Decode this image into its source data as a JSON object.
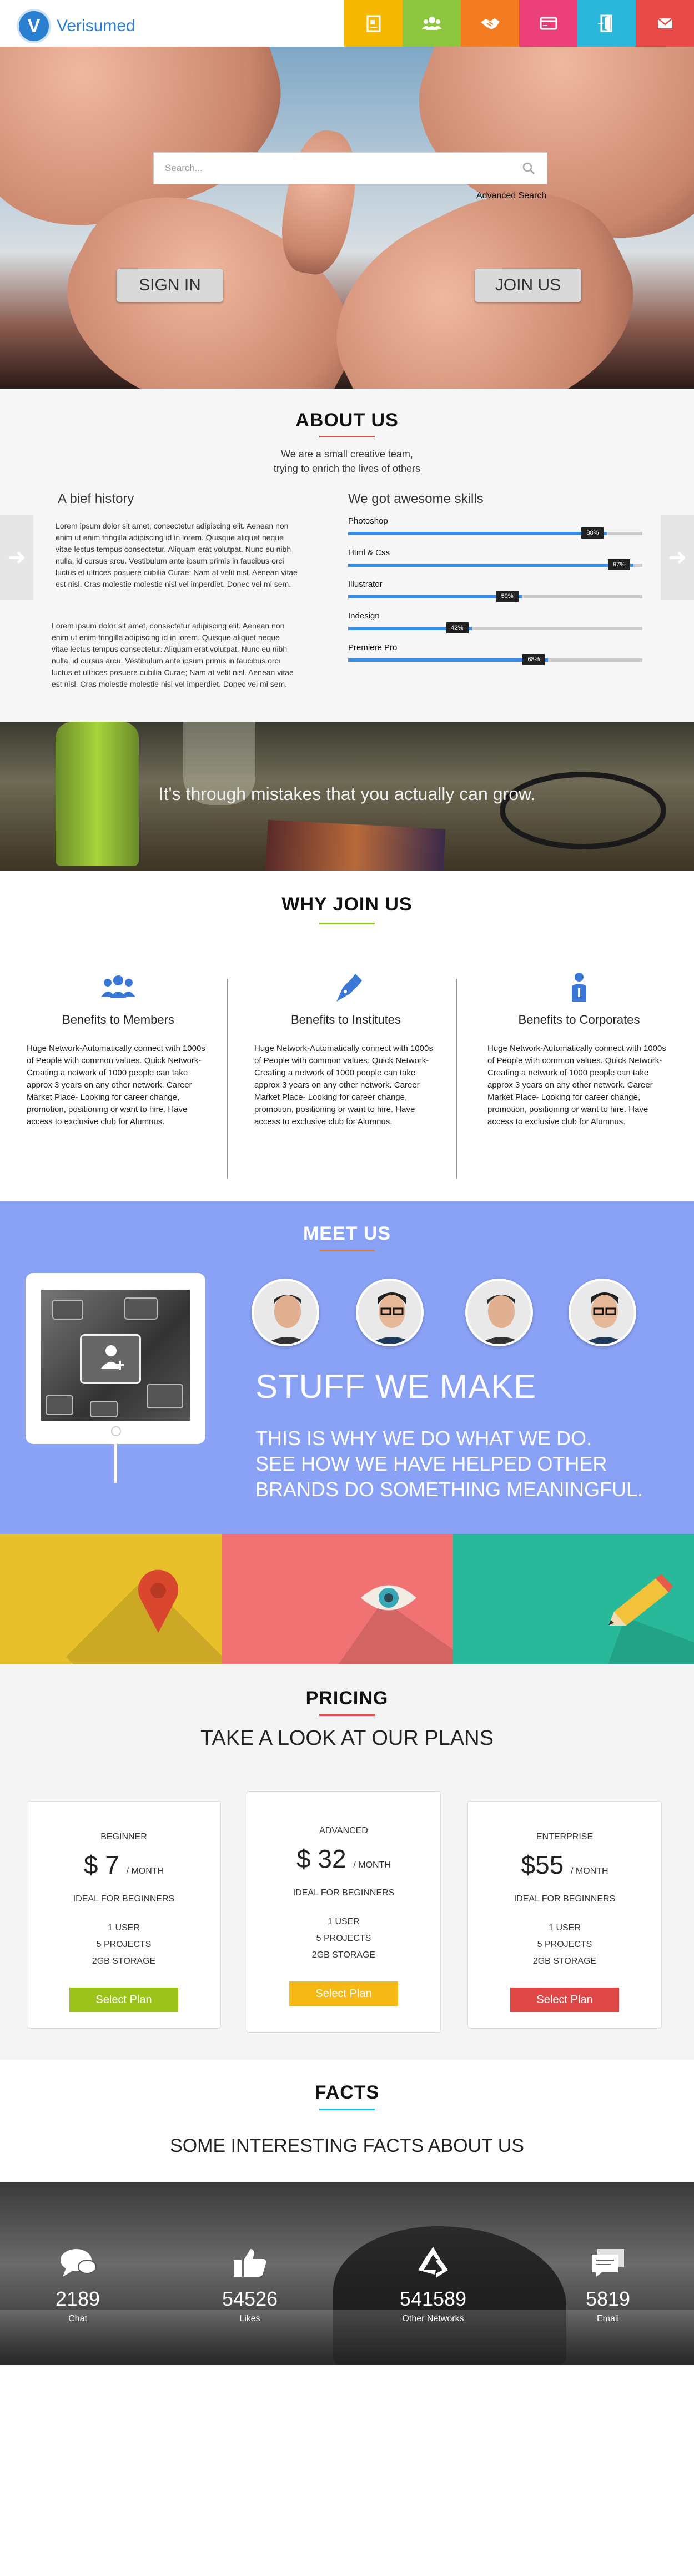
{
  "header": {
    "logo_text": "Verisumed",
    "logo_letter": "V",
    "nav": [
      {
        "icon": "document-icon",
        "color": "#f5b700"
      },
      {
        "icon": "users-icon",
        "color": "#8cc63f"
      },
      {
        "icon": "handshake-icon",
        "color": "#f47c20"
      },
      {
        "icon": "card-icon",
        "color": "#ec407a"
      },
      {
        "icon": "door-icon",
        "color": "#29b6d8"
      },
      {
        "icon": "mail-icon",
        "color": "#e84a4a"
      }
    ]
  },
  "hero": {
    "search_placeholder": "Search...",
    "advanced_search": "Advanced Search",
    "sign_in": "SIGN IN",
    "join_us": "JOIN US"
  },
  "about": {
    "title": "ABOUT US",
    "accent": "#e84a4a",
    "subtitle_line1": "We are a small creative team,",
    "subtitle_line2": "trying to enrich the lives of others",
    "history_title": "A bief history",
    "history_p1": "Lorem ipsum dolor sit amet, consectetur adipiscing elit. Aenean non enim ut enim fringilla adipiscing id in lorem. Quisque aliquet neque vitae lectus tempus consectetur. Aliquam erat volutpat. Nunc eu nibh nulla, id cursus arcu. Vestibulum ante ipsum primis in faucibus orci luctus et ultrices posuere cubilia Curae; Nam at velit nisl. Aenean vitae est nisl. Cras molestie molestie nisl vel imperdiet. Donec vel mi sem.",
    "history_p2": "Lorem ipsum dolor sit amet, consectetur adipiscing elit. Aenean non enim ut enim fringilla adipiscing id in lorem. Quisque aliquet neque vitae lectus tempus consectetur. Aliquam erat volutpat. Nunc eu nibh nulla, id cursus arcu. Vestibulum ante ipsum primis in faucibus orci luctus et ultrices posuere cubilia Curae; Nam at velit nisl. Aenean vitae est nisl. Cras molestie molestie nisl vel imperdiet. Donec vel mi sem.",
    "skills_title": "We got awesome skills",
    "skills": [
      {
        "name": "Photoshop",
        "value": 88,
        "label": "88%"
      },
      {
        "name": "Html & Css",
        "value": 97,
        "label": "97%"
      },
      {
        "name": "Illustrator",
        "value": 59,
        "label": "59%"
      },
      {
        "name": "Indesign",
        "value": 42,
        "label": "42%"
      },
      {
        "name": "Premiere Pro",
        "value": 68,
        "label": "68%"
      }
    ]
  },
  "quote": {
    "text": "It's through mistakes that you actually can grow."
  },
  "why": {
    "title": "WHY JOIN US",
    "accent": "#8cc63f",
    "columns": [
      {
        "icon": "members-icon",
        "title": "Benefits to Members",
        "text": "Huge Network-Automatically connect with 1000s of People with common values. Quick Network- Creating a network of 1000 people can take approx 3 years on any other network. Career Market Place- Looking for career change, promotion, positioning or want to hire. Have access to exclusive club for Alumnus."
      },
      {
        "icon": "pen-icon",
        "title": "Benefits to Institutes",
        "text": "Huge Network-Automatically connect with 1000s of People with common values. Quick Network- Creating a network of 1000 people can take approx 3 years on any other network. Career Market Place- Looking for career change, promotion, positioning or want to hire. Have access to exclusive club for Alumnus."
      },
      {
        "icon": "person-info-icon",
        "title": "Benefits to Corporates",
        "text": "Huge Network-Automatically connect with 1000s of People with common values. Quick Network- Creating a network of 1000 people can take approx 3 years on any other network. Career Market Place- Looking for career change, promotion, positioning or want to hire. Have access to exclusive club for Alumnus."
      }
    ]
  },
  "meet": {
    "title": "MEET US",
    "accent": "#f47c20",
    "stuff_title": "STUFF WE MAKE",
    "stuff_line1": "THIS IS WHY WE DO WHAT WE DO.",
    "stuff_line2": "SEE HOW WE HAVE HELPED OTHER",
    "stuff_line3": "BRANDS DO SOMETHING MEANINGFUL."
  },
  "tiles": [
    {
      "icon": "location-pin-icon",
      "color": "#e8c02a"
    },
    {
      "icon": "eye-icon",
      "color": "#f07272"
    },
    {
      "icon": "pencil-icon",
      "color": "#27b99a"
    }
  ],
  "pricing": {
    "title": "PRICING",
    "accent": "#e84a4a",
    "tagline": "TAKE A LOOK AT OUR PLANS",
    "plans": [
      {
        "name": "BEGINNER",
        "price": "$ 7",
        "period": "/ MONTH",
        "desc": "IDEAL FOR BEGINNERS",
        "users": "1 USER",
        "projects": "5 PROJECTS",
        "storage": "2GB STORAGE",
        "button": "Select Plan",
        "color": "#9cc31a"
      },
      {
        "name": "ADVANCED",
        "price": "$ 32",
        "period": "/ MONTH",
        "desc": "IDEAL FOR BEGINNERS",
        "users": "1 USER",
        "projects": "5 PROJECTS",
        "storage": "2GB STORAGE",
        "button": "Select Plan",
        "color": "#f7b916"
      },
      {
        "name": "ENTERPRISE",
        "price": "$55",
        "period": "/ MONTH",
        "desc": "IDEAL FOR BEGINNERS",
        "users": "1 USER",
        "projects": "5 PROJECTS",
        "storage": "2GB STORAGE",
        "button": "Select Plan",
        "color": "#e04848"
      }
    ]
  },
  "facts": {
    "title": "FACTS",
    "accent": "#29b6d8",
    "tagline": "SOME INTERESTING FACTS ABOUT US",
    "stats": [
      {
        "icon": "chat-icon",
        "number": "2189",
        "label": "Chat"
      },
      {
        "icon": "like-icon",
        "number": "54526",
        "label": "Likes"
      },
      {
        "icon": "recycle-icon",
        "number": "541589",
        "label": "Other Networks"
      },
      {
        "icon": "email-icon",
        "number": "5819",
        "label": "Email"
      }
    ]
  }
}
